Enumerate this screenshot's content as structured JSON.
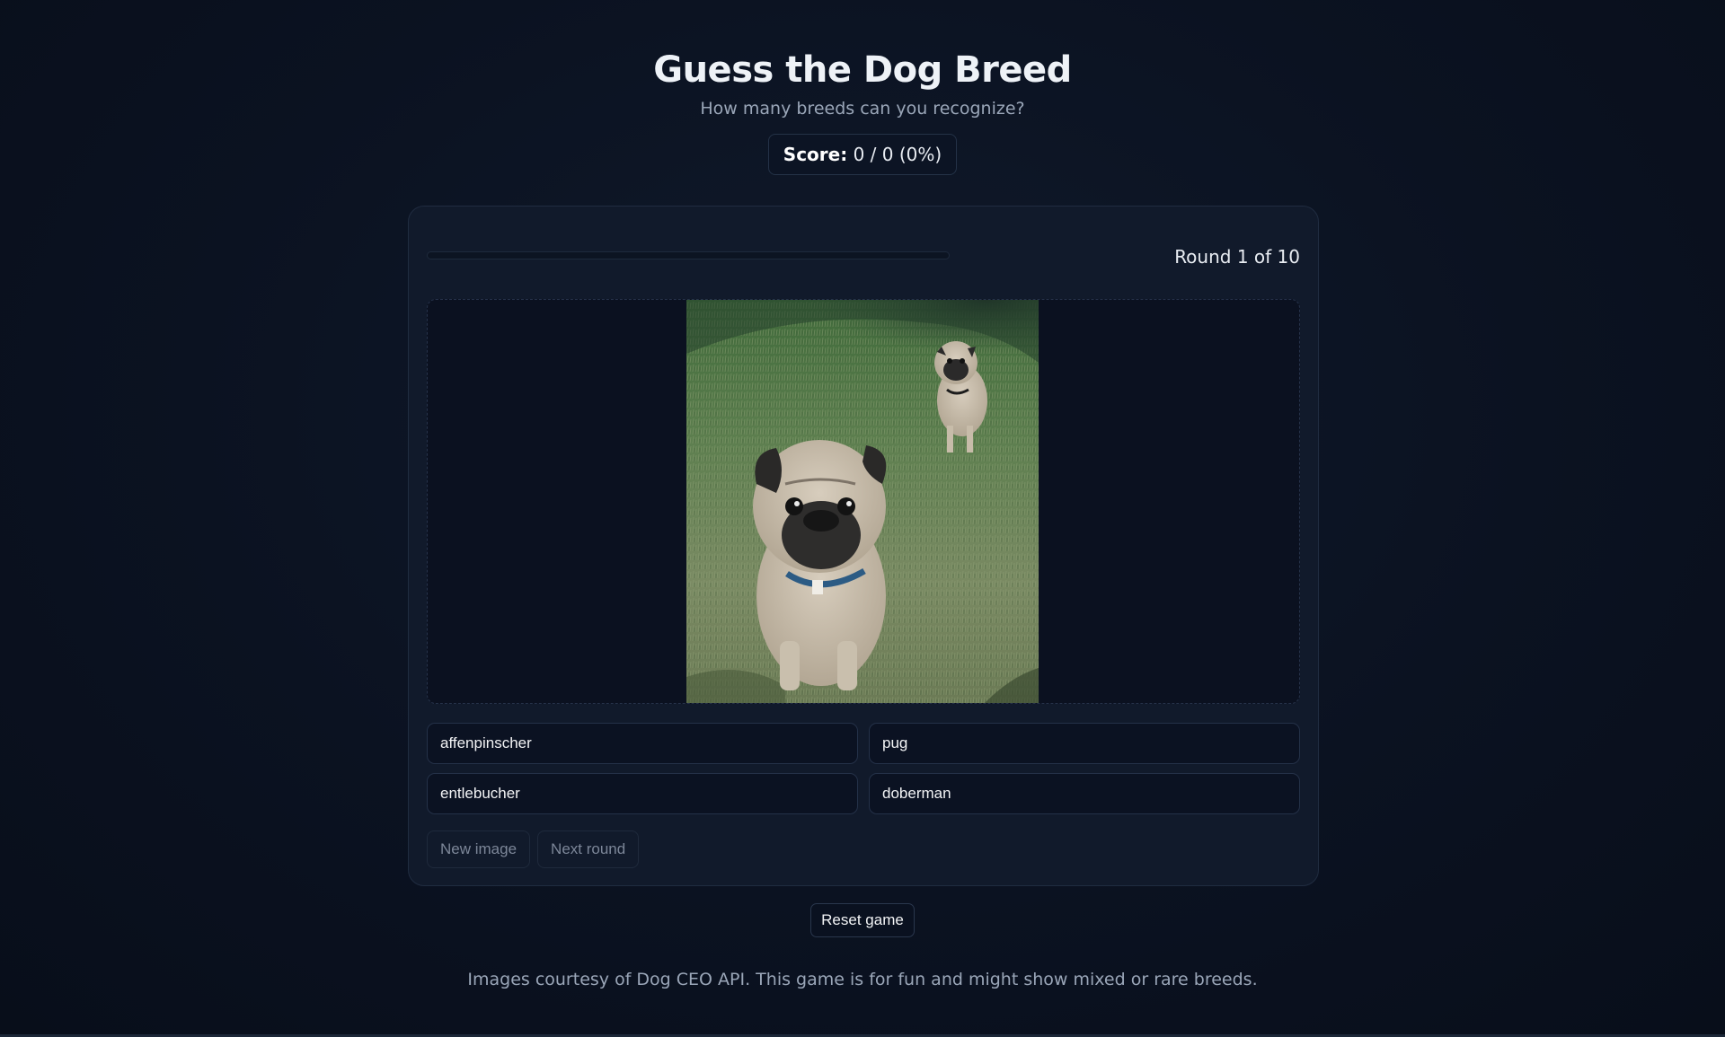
{
  "header": {
    "title": "Guess the Dog Breed",
    "subtitle": "How many breeds can you recognize?"
  },
  "score": {
    "label": "Score:",
    "value": "0 / 0 (0%)"
  },
  "game": {
    "progress_fraction": 0,
    "round_label": "Round 1 of 10",
    "image": {
      "subject": "pug",
      "description_icon": "dog-photo"
    },
    "choices": [
      {
        "label": "affenpinscher"
      },
      {
        "label": "pug"
      },
      {
        "label": "entlebucher"
      },
      {
        "label": "doberman"
      }
    ],
    "actions": {
      "new_image": "New image",
      "next_round": "Next round"
    }
  },
  "reset_label": "Reset game",
  "footer": "Images courtesy of Dog CEO API. This game is for fun and might show mixed or rare breeds.",
  "colors": {
    "background": "#0b1221",
    "card": "#111a2b",
    "accent": "#3b82f6",
    "muted_text": "#9aa6b8"
  }
}
